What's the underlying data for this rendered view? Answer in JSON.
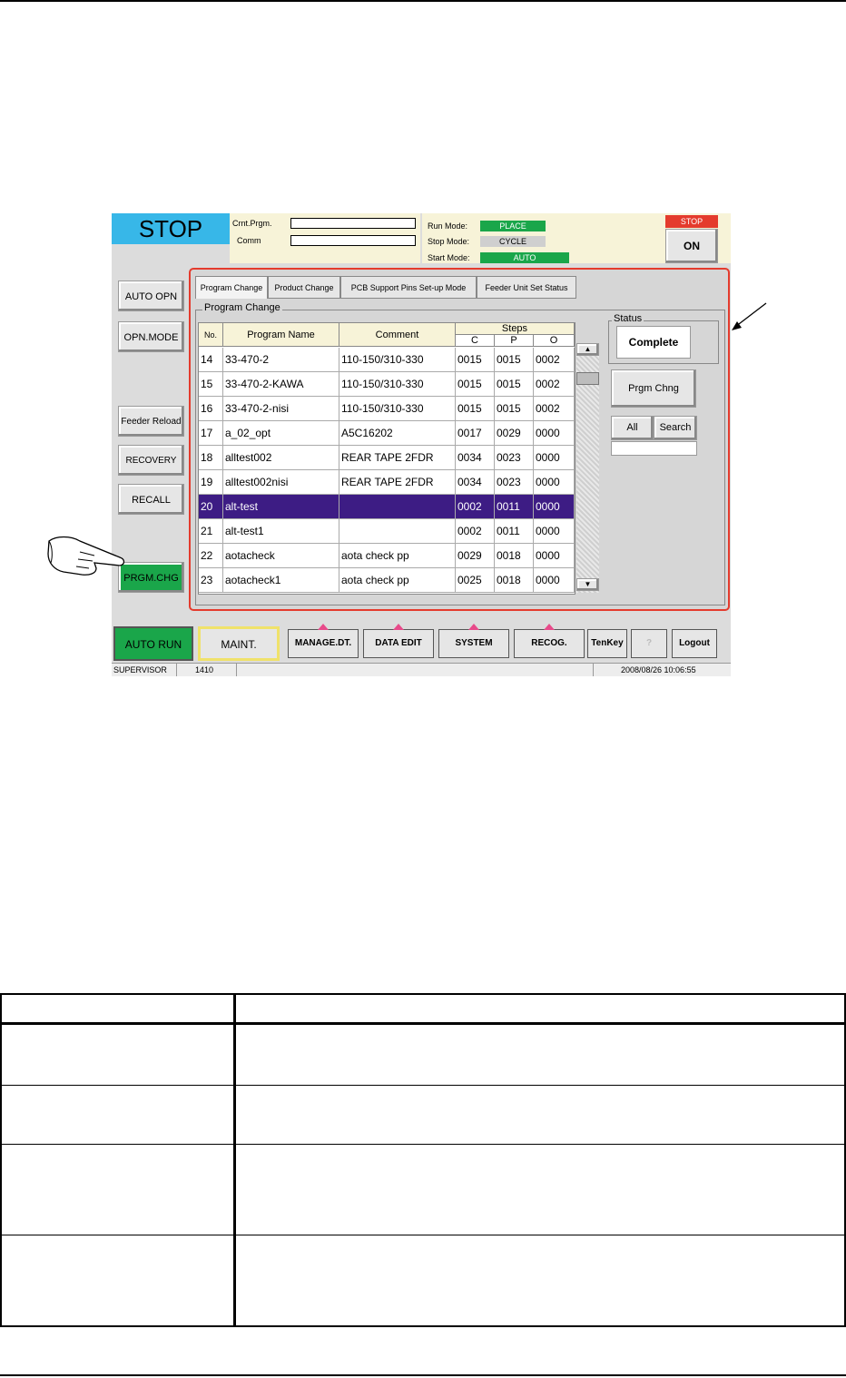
{
  "screen": {
    "status": "STOP",
    "crnt_prgm_label": "Crnt.Prgm.",
    "comm_label": "Comm",
    "run_mode_label": "Run Mode:",
    "run_mode_value": "PLACE",
    "stop_mode_label": "Stop Mode:",
    "stop_mode_value": "CYCLE",
    "start_mode_label": "Start Mode:",
    "start_mode_value": "AUTO",
    "stop_indicator": "STOP",
    "on_button": "ON",
    "side_buttons": [
      "AUTO OPN",
      "OPN.MODE",
      "Feeder Reload",
      "RECOVERY",
      "RECALL",
      "PRGM.CHG"
    ],
    "tabs": [
      "Program Change",
      "Product Change",
      "PCB Support Pins Set-up Mode",
      "Feeder Unit Set Status"
    ],
    "group_label": "Program Change",
    "columns": {
      "no": "No.",
      "name": "Program Name",
      "comment": "Comment",
      "steps": "Steps",
      "c": "C",
      "p": "P",
      "o": "O"
    },
    "rows": [
      {
        "no": "14",
        "name": "33-470-2",
        "comment": "110-150/310-330",
        "c": "0015",
        "p": "0015",
        "o": "0002"
      },
      {
        "no": "15",
        "name": "33-470-2-KAWA",
        "comment": "110-150/310-330",
        "c": "0015",
        "p": "0015",
        "o": "0002"
      },
      {
        "no": "16",
        "name": "33-470-2-nisi",
        "comment": "110-150/310-330",
        "c": "0015",
        "p": "0015",
        "o": "0002"
      },
      {
        "no": "17",
        "name": "a_02_opt",
        "comment": "A5C16202",
        "c": "0017",
        "p": "0029",
        "o": "0000"
      },
      {
        "no": "18",
        "name": "alltest002",
        "comment": "REAR  TAPE 2FDR",
        "c": "0034",
        "p": "0023",
        "o": "0000"
      },
      {
        "no": "19",
        "name": "alltest002nisi",
        "comment": "REAR  TAPE 2FDR",
        "c": "0034",
        "p": "0023",
        "o": "0000"
      },
      {
        "no": "20",
        "name": "alt-test",
        "comment": "",
        "c": "0002",
        "p": "0011",
        "o": "0000"
      },
      {
        "no": "21",
        "name": "alt-test1",
        "comment": "",
        "c": "0002",
        "p": "0011",
        "o": "0000"
      },
      {
        "no": "22",
        "name": "aotacheck",
        "comment": "aota check pp",
        "c": "0029",
        "p": "0018",
        "o": "0000"
      },
      {
        "no": "23",
        "name": "aotacheck1",
        "comment": "aota check pp",
        "c": "0025",
        "p": "0018",
        "o": "0000"
      }
    ],
    "selected_row": "20",
    "status_label": "Status",
    "status_value": "Complete",
    "prgm_chng_button": "Prgm Chng",
    "all_button": "All",
    "search_button": "Search",
    "bottom_buttons": [
      "AUTO RUN",
      "MAINT.",
      "MANAGE.DT.",
      "DATA EDIT",
      "SYSTEM",
      "RECOG.",
      "TenKey",
      "?",
      "Logout"
    ],
    "status_bar": {
      "user": "SUPERVISOR",
      "code": "1410",
      "datetime": "2008/08/26 10:06:55"
    }
  },
  "colors": {
    "stop_bg": "#37b7e8",
    "accent_green": "#1aa64a",
    "selection": "#3d1c84",
    "frame_red": "#e43b2d"
  }
}
